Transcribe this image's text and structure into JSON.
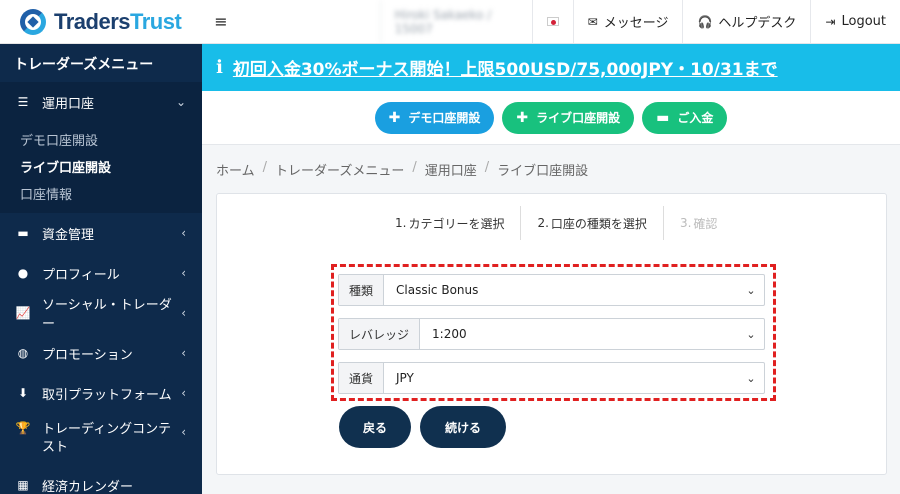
{
  "brand": {
    "name_part1": "Traders",
    "name_part2": "Trust"
  },
  "sidebar": {
    "menu_title": "トレーダーズメニュー",
    "active_group": {
      "label": "運用口座",
      "icon": "list-icon"
    },
    "sub_items": [
      {
        "label": "デモ口座開設"
      },
      {
        "label": "ライブ口座開設",
        "current": true
      },
      {
        "label": "口座情報"
      }
    ],
    "items": [
      {
        "label": "資金管理",
        "icon": "card-icon"
      },
      {
        "label": "プロフィール",
        "icon": "user-icon"
      },
      {
        "label": "ソーシャル・トレーダー",
        "icon": "chart-line-icon"
      },
      {
        "label": "プロモーション",
        "icon": "globe-icon"
      },
      {
        "label": "取引プラットフォーム",
        "icon": "download-icon"
      },
      {
        "label": "トレーディングコンテスト",
        "icon": "trophy-icon"
      },
      {
        "label": "経済カレンダー",
        "icon": "calendar-icon"
      }
    ]
  },
  "topbar": {
    "user_name": "Hiroki Sakaeko / 15007",
    "language_flag": "japan-flag-icon",
    "messages_label": "メッセージ",
    "helpdesk_label": "ヘルプデスク",
    "logout_label": "Logout"
  },
  "banner": {
    "text": "初回入金30%ボーナス開始！上限500USD/75,000JPY・10/31まで",
    "color": "#18bde9"
  },
  "actions": {
    "demo_label": "デモ口座開設",
    "live_label": "ライブ口座開設",
    "deposit_label": "ご入金"
  },
  "breadcrumb": [
    "ホーム",
    "トレーダーズメニュー",
    "運用口座",
    "ライブ口座開設"
  ],
  "steps": [
    {
      "num": "1.",
      "label": "カテゴリーを選択"
    },
    {
      "num": "2.",
      "label": "口座の種類を選択"
    },
    {
      "num": "3.",
      "label": "確認"
    }
  ],
  "form": {
    "type": {
      "label": "種類",
      "value": "Classic Bonus"
    },
    "leverage": {
      "label": "レバレッジ",
      "value": "1:200"
    },
    "currency": {
      "label": "通貨",
      "value": "JPY"
    }
  },
  "buttons": {
    "back_label": "戻る",
    "continue_label": "続ける"
  },
  "colors": {
    "sidebar": "#0e2a4b",
    "accent_blue": "#1a9fe0",
    "accent_green": "#18c17e",
    "highlight": "#e02020"
  }
}
